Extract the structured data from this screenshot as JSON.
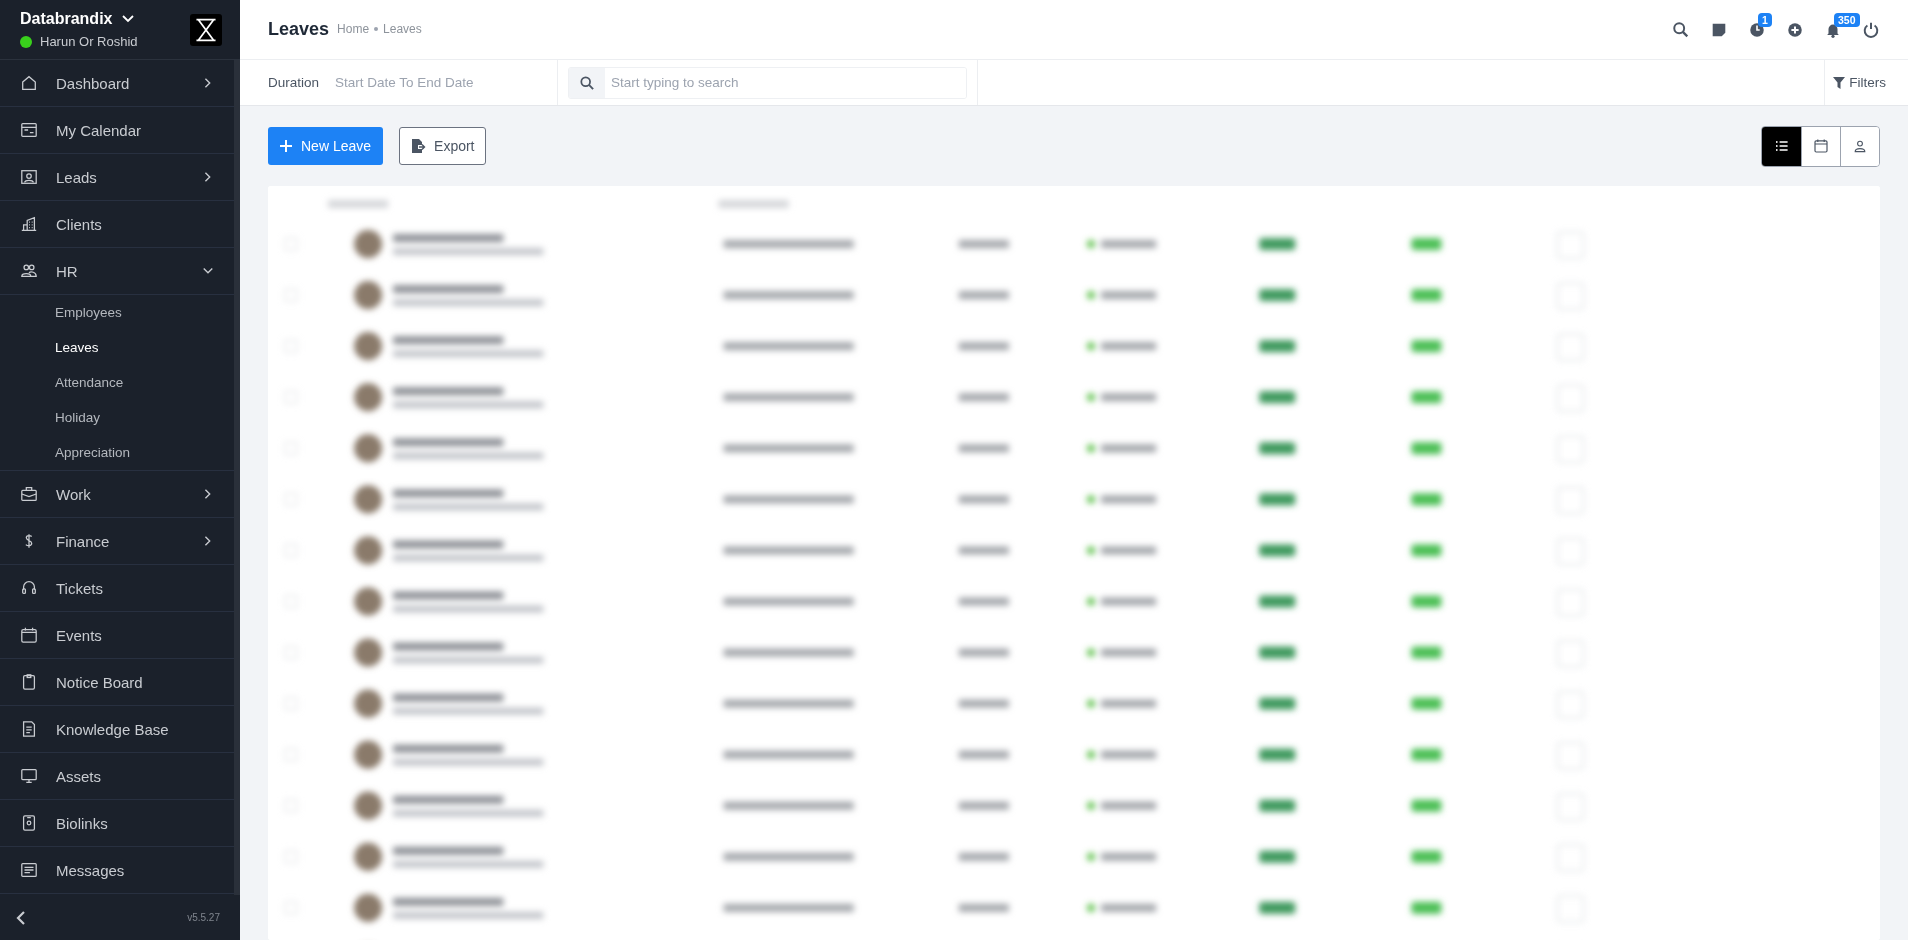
{
  "sidebar": {
    "company": "Databrandix",
    "user": {
      "name": "Harun Or Roshid",
      "online": true
    },
    "items": [
      {
        "label": "Dashboard",
        "expanded": false
      },
      {
        "label": "My Calendar"
      },
      {
        "label": "Leads",
        "expanded": false
      },
      {
        "label": "Clients"
      },
      {
        "label": "HR",
        "expanded": true,
        "children": [
          {
            "label": "Employees",
            "selected": false
          },
          {
            "label": "Leaves",
            "selected": true
          },
          {
            "label": "Attendance",
            "selected": false
          },
          {
            "label": "Holiday",
            "selected": false
          },
          {
            "label": "Appreciation",
            "selected": false
          }
        ]
      },
      {
        "label": "Work",
        "expanded": false
      },
      {
        "label": "Finance",
        "expanded": false
      },
      {
        "label": "Tickets"
      },
      {
        "label": "Events"
      },
      {
        "label": "Notice Board"
      },
      {
        "label": "Knowledge Base"
      },
      {
        "label": "Assets"
      },
      {
        "label": "Biolinks"
      },
      {
        "label": "Messages"
      }
    ],
    "version": "v5.5.27"
  },
  "header": {
    "title": "Leaves",
    "breadcrumb": [
      "Home",
      "Leaves"
    ],
    "icons": [
      {
        "kind": "search"
      },
      {
        "kind": "note"
      },
      {
        "kind": "clock",
        "badge": "1"
      },
      {
        "kind": "add"
      },
      {
        "kind": "bell",
        "badge": "350"
      },
      {
        "kind": "power"
      }
    ]
  },
  "filter_bar": {
    "duration_label": "Duration",
    "duration_placeholder": "Start Date To End Date",
    "search": {
      "placeholder": "Start typing to search"
    },
    "filters": "Filters"
  },
  "toolbar": {
    "new_button": "New Leave",
    "export_button": "Export",
    "views": [
      {
        "selected": true
      },
      {
        "selected": false
      },
      {
        "selected": false
      }
    ]
  }
}
